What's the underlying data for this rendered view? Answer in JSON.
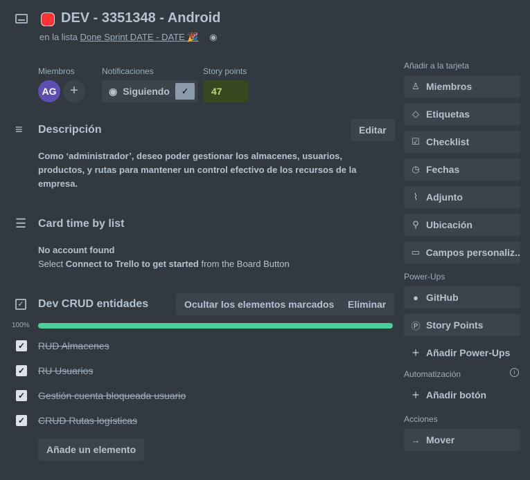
{
  "header": {
    "title": "DEV - 3351348 - Android",
    "list_prefix": "en la lista",
    "list_name": "Done Sprint DATE - DATE 🎉"
  },
  "meta": {
    "members_label": "Miembros",
    "avatar": "AG",
    "notifications_label": "Notificaciones",
    "following": "Siguiendo",
    "story_points_label": "Story points",
    "story_points": "47"
  },
  "description": {
    "title": "Descripción",
    "edit": "Editar",
    "text": "Como ‘administrador’, deseo poder gestionar los almacenes, usuarios, productos, y rutas para mantener un control efectivo de los recursos de la empresa."
  },
  "card_time": {
    "title": "Card time by list",
    "no_account": "No account found",
    "pre": "Select ",
    "bold": "Connect to Trello to get started",
    "post": " from the Board Button"
  },
  "checklist": {
    "title": "Dev CRUD entidades",
    "hide": "Ocultar los elementos marcados",
    "delete": "Eliminar",
    "progress_label": "100%",
    "progress": 1.0,
    "items": [
      "RUD Almacenes",
      "RU Usuarios",
      "Gestión cuenta bloqueada usuario",
      "CRUD Rutas logísticas"
    ],
    "add": "Añade un elemento"
  },
  "sidebar": {
    "add_title": "Añadir a la tarjeta",
    "add": [
      "Miembros",
      "Etiquetas",
      "Checklist",
      "Fechas",
      "Adjunto",
      "Ubicación",
      "Campos personaliz..."
    ],
    "powerups_title": "Power-Ups",
    "powerups": [
      "GitHub",
      "Story Points"
    ],
    "add_powerups": "Añadir Power-Ups",
    "automation_title": "Automatización",
    "add_button": "Añadir botón",
    "actions_title": "Acciones",
    "actions": [
      "Mover"
    ]
  }
}
